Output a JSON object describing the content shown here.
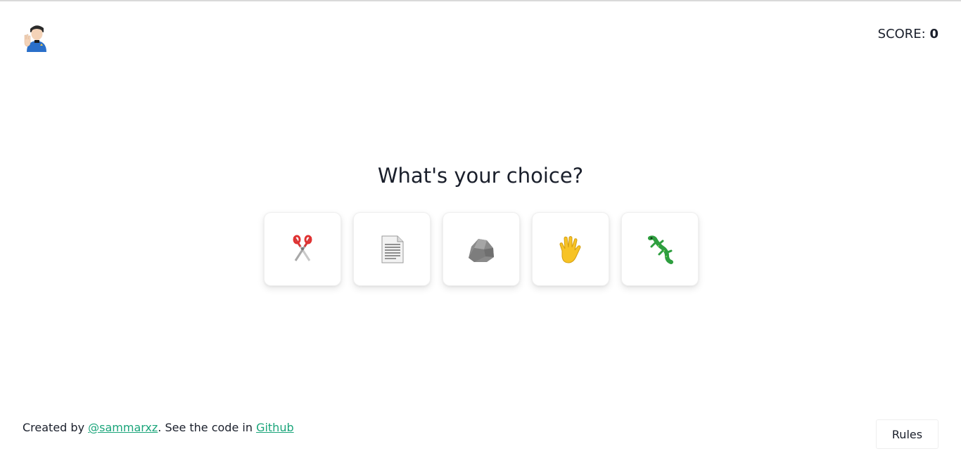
{
  "header": {
    "avatar_icon": "vulcan-salute-person-icon",
    "score_label": "SCORE: ",
    "score_value": "0"
  },
  "main": {
    "title": "What's your choice?",
    "choices": [
      {
        "id": "scissors",
        "icon": "scissors-icon"
      },
      {
        "id": "paper",
        "icon": "paper-icon"
      },
      {
        "id": "rock",
        "icon": "rock-icon"
      },
      {
        "id": "spock",
        "icon": "vulcan-hand-icon"
      },
      {
        "id": "lizard",
        "icon": "lizard-icon"
      }
    ]
  },
  "footer": {
    "created_by": "Created by ",
    "author_link": "@sammarxz",
    "see_code": ". See the code in ",
    "github_link": "Github",
    "rules_button": "Rules"
  },
  "colors": {
    "text": "#1a1f2b",
    "link": "#1aa57a",
    "background": "#ffffff"
  }
}
